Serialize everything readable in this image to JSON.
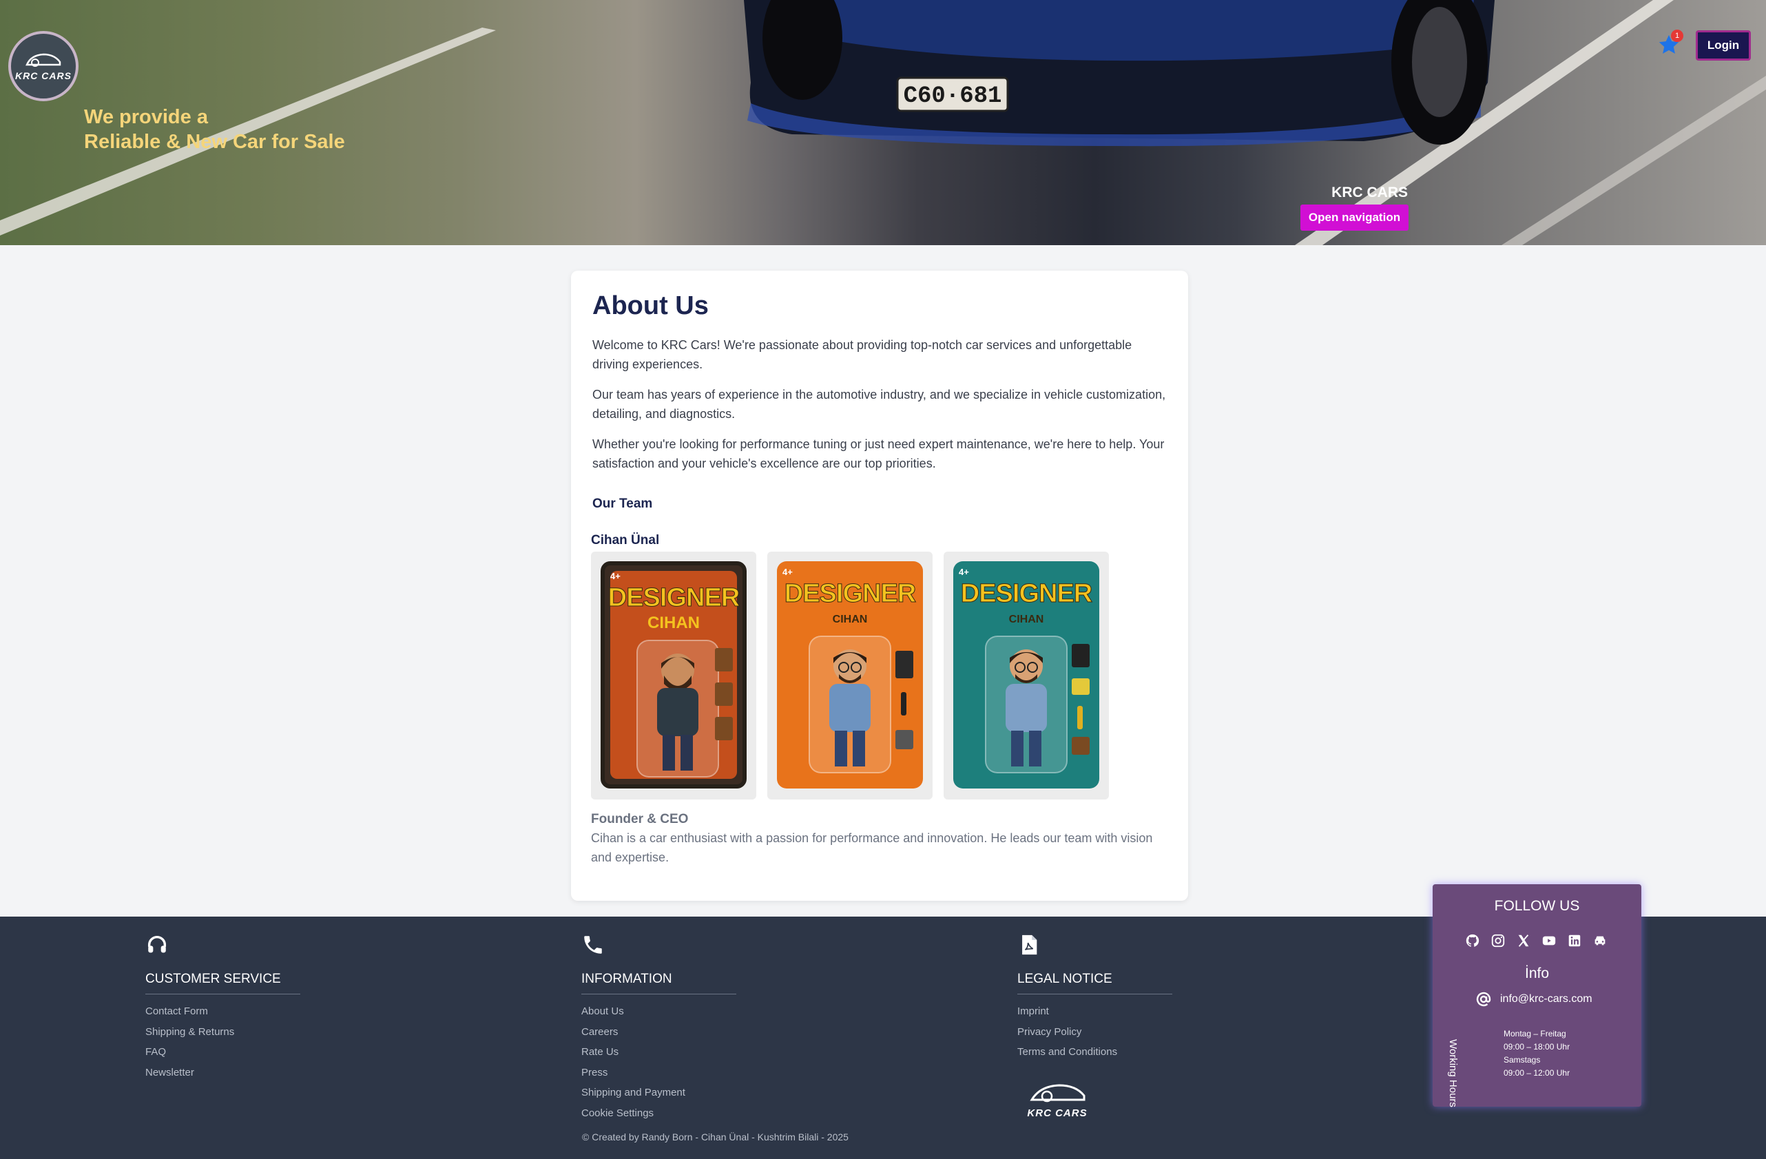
{
  "hero": {
    "logo_text": "KRC CARS",
    "tagline_line1": "We provide a",
    "tagline_line2": "Reliable & New Car for Sale",
    "plate": "C60·681",
    "favorites_count": "1",
    "login_label": "Login",
    "brand_label": "KRC CARS",
    "nav_button_label": "Open navigation"
  },
  "about": {
    "title": "About Us",
    "paragraphs": [
      "Welcome to KRC Cars! We're passionate about providing top-notch car services and unforgettable driving experiences.",
      "Our team has years of experience in the automotive industry, and we specialize in vehicle customization, detailing, and diagnostics.",
      "Whether you're looking for performance tuning or just need expert maintenance, we're here to help. Your satisfaction and your vehicle's excellence are our top priorities."
    ],
    "team_heading": "Our Team",
    "member": {
      "name": "Cihan Ünal",
      "figures": [
        {
          "title": "DESIGNER",
          "subtitle": "CIHAN",
          "age": "4+"
        },
        {
          "title": "DESIGNER",
          "subtitle": "CIHAN",
          "age": "4+"
        },
        {
          "title": "DESIGNER",
          "subtitle": "CIHAN",
          "age": "4+"
        }
      ],
      "role": "Founder & CEO",
      "bio": "Cihan is a car enthusiast with a passion for performance and innovation. He leads our team with vision and expertise."
    }
  },
  "footer": {
    "customer_service": {
      "icon": "headset-icon",
      "title": "CUSTOMER SERVICE",
      "links": [
        "Contact Form",
        "Shipping & Returns",
        "FAQ",
        "Newsletter"
      ]
    },
    "information": {
      "icon": "phone-icon",
      "title": "INFORMATION",
      "links": [
        "About Us",
        "Careers",
        "Rate Us",
        "Press",
        "Shipping and Payment",
        "Cookie Settings"
      ]
    },
    "legal": {
      "icon": "pdf-file-icon",
      "title": "LEGAL NOTICE",
      "links": [
        "Imprint",
        "Privacy Policy",
        "Terms and Conditions"
      ]
    },
    "logo_text": "KRC CARS",
    "copyright": "© Created by Randy Born - Cihan Ünal - Kushtrim Bilali - 2025"
  },
  "follow": {
    "title": "FOLLOW US",
    "socials": [
      "github-icon",
      "instagram-icon",
      "x-icon",
      "youtube-icon",
      "linkedin-icon",
      "car-icon"
    ],
    "info_heading": "İnfo",
    "email": "info@krc-cars.com",
    "working_hours_label": "Working Hours",
    "hours": [
      "Montag – Freitag",
      "09:00 – 18:00 Uhr",
      "Samstags",
      "09:00 – 12:00 Uhr"
    ]
  },
  "colors": {
    "accent_navy": "#1c2550",
    "nav_button": "#d10fd4",
    "login_bg": "#1a1650",
    "footer_bg": "#2d3647",
    "follow_bg": "#6a4a7a",
    "tagline": "#f5d57a"
  }
}
